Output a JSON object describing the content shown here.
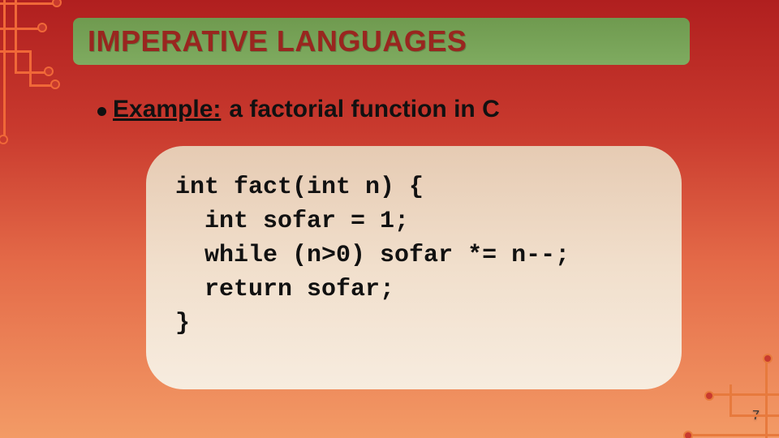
{
  "colors": {
    "bg_top": "#b01f1f",
    "bg_bottom": "#f39b66",
    "title_bar": "#7fab60",
    "title_text": "#99261f",
    "text": "#111111",
    "codebox": "#f1dfcc",
    "trace": "#f06838"
  },
  "slide": {
    "title": "IMPERATIVE LANGUAGES",
    "bullet_label": "Example:",
    "bullet_rest": "a factorial function in C",
    "code_lines": [
      "int fact(int n) {",
      "  int sofar = 1;",
      "  while (n>0) sofar *= n--;",
      "  return sofar;",
      "}"
    ],
    "page_number": "7"
  }
}
